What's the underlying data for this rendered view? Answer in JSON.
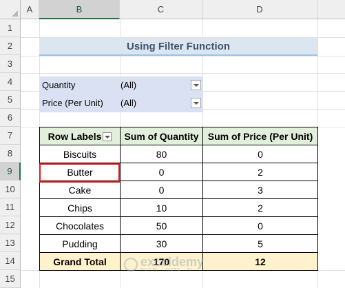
{
  "columns": [
    "A",
    "B",
    "C",
    "D"
  ],
  "rows": [
    "1",
    "2",
    "3",
    "4",
    "5",
    "6",
    "7",
    "8",
    "9",
    "10",
    "11",
    "12",
    "13",
    "14",
    "15"
  ],
  "title": "Using Filter Function",
  "filters": [
    {
      "label": "Quantity",
      "value": "(All)"
    },
    {
      "label": "Price (Per Unit)",
      "value": "(All)"
    }
  ],
  "pivot": {
    "headers": [
      "Row Labels",
      "Sum of Quantity",
      "Sum of Price (Per Unit)"
    ],
    "rows": [
      {
        "label": "Biscuits",
        "qty": "80",
        "price": "0"
      },
      {
        "label": "Butter",
        "qty": "0",
        "price": "2"
      },
      {
        "label": "Cake",
        "qty": "0",
        "price": "3"
      },
      {
        "label": "Chips",
        "qty": "10",
        "price": "2"
      },
      {
        "label": "Chocolates",
        "qty": "50",
        "price": "0"
      },
      {
        "label": "Pudding",
        "qty": "30",
        "price": "5"
      }
    ],
    "total": {
      "label": "Grand Total",
      "qty": "170",
      "price": "12"
    }
  },
  "watermark": {
    "name": "exceldemy",
    "tagline": "EXCEL · DATA · BI"
  },
  "colors": {
    "accent": "#217346",
    "highlight": "#e5161b",
    "header_fill": "#e2efda",
    "total_fill": "#fff2cc",
    "filter_fill": "#d9e1f2"
  }
}
